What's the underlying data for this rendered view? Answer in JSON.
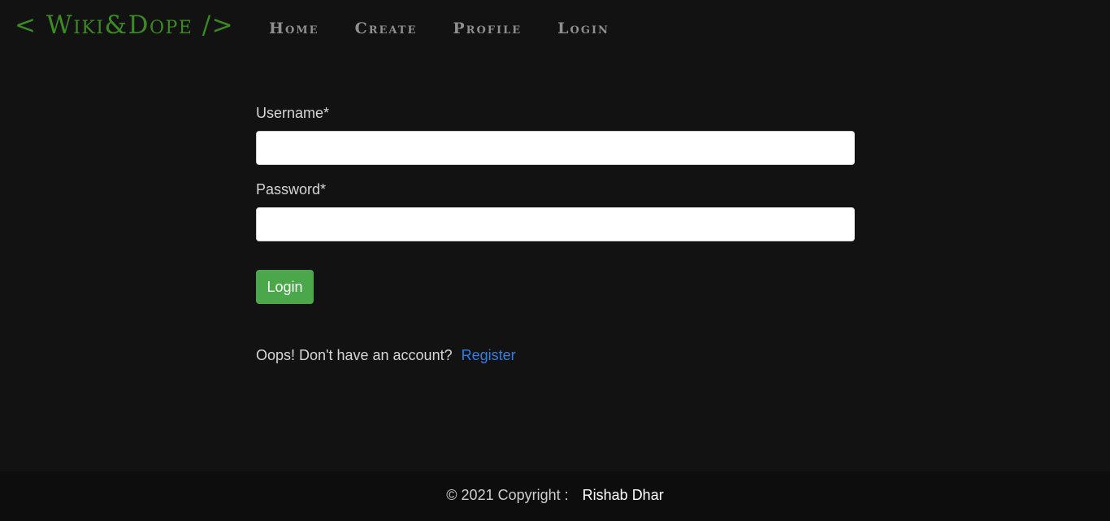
{
  "navbar": {
    "brand": "< Wiki&Dope />",
    "links": [
      "Home",
      "Create",
      "Profile",
      "Login"
    ]
  },
  "form": {
    "username_label": "Username*",
    "username_value": "",
    "password_label": "Password*",
    "password_value": "",
    "submit_label": "Login"
  },
  "register": {
    "prompt": "Oops! Don't have an account?",
    "link_label": "Register"
  },
  "footer": {
    "copyright": "© 2021 Copyright :",
    "author": "Rishab Dhar"
  },
  "colors": {
    "background": "#121212",
    "brand": "#3b8a22",
    "nav_link": "#8f8f8f",
    "button": "#4aa84a",
    "link": "#2f7fe8",
    "footer_bg": "#0d0d0d"
  }
}
